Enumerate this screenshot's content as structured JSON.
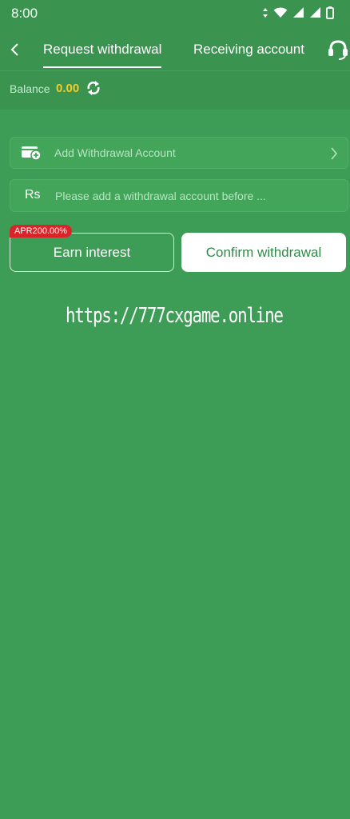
{
  "status_bar": {
    "time": "8:00"
  },
  "nav": {
    "back_icon": "chevron-left-icon",
    "tabs": [
      {
        "label": "Request withdrawal",
        "active": true
      },
      {
        "label": "Receiving account",
        "active": false
      }
    ],
    "support_icon": "headset-icon"
  },
  "balance": {
    "label": "Balance",
    "value": "0.00",
    "refresh_icon": "refresh-icon"
  },
  "account_row": {
    "label": "Add Withdrawal Account",
    "icon": "wallet-add-icon"
  },
  "amount_row": {
    "currency": "Rs",
    "placeholder": "Please add a withdrawal account before ..."
  },
  "buttons": {
    "earn_label": "Earn interest",
    "apr_badge": "APR200.00%",
    "confirm_label": "Confirm withdrawal"
  },
  "watermark": "https://777cxgame.online",
  "colors": {
    "background": "#3d9c55",
    "accent_yellow": "#f4cc2a",
    "badge_red": "#d9252a"
  }
}
